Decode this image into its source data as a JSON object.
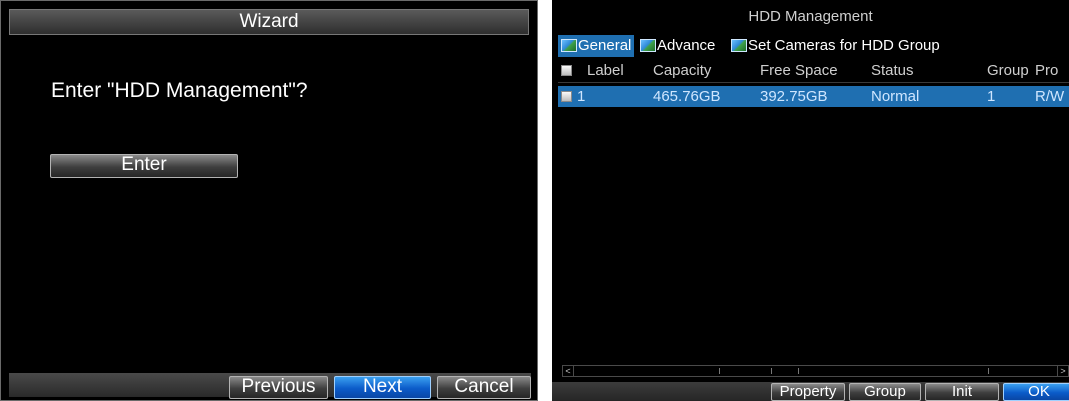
{
  "wizard": {
    "title": "Wizard",
    "question": "Enter \"HDD Management\"?",
    "enter_label": "Enter",
    "previous_label": "Previous",
    "next_label": "Next",
    "cancel_label": "Cancel"
  },
  "hdd": {
    "title": "HDD Management",
    "tabs": [
      {
        "label": "General",
        "active": true
      },
      {
        "label": "Advance",
        "active": false
      },
      {
        "label": "Set Cameras for HDD Group",
        "active": false
      }
    ],
    "columns": [
      "Label",
      "Capacity",
      "Free Space",
      "Status",
      "Group",
      "Pro"
    ],
    "rows": [
      {
        "label": "1",
        "capacity": "465.76GB",
        "free_space": "392.75GB",
        "status": "Normal",
        "group": "1",
        "property": "R/W"
      }
    ],
    "buttons": {
      "property": "Property",
      "group": "Group",
      "init": "Init",
      "ok": "OK"
    }
  },
  "colors": {
    "selected_row": "#1f6fb1",
    "primary_button": "#0b5bc9",
    "background": "#000000"
  }
}
